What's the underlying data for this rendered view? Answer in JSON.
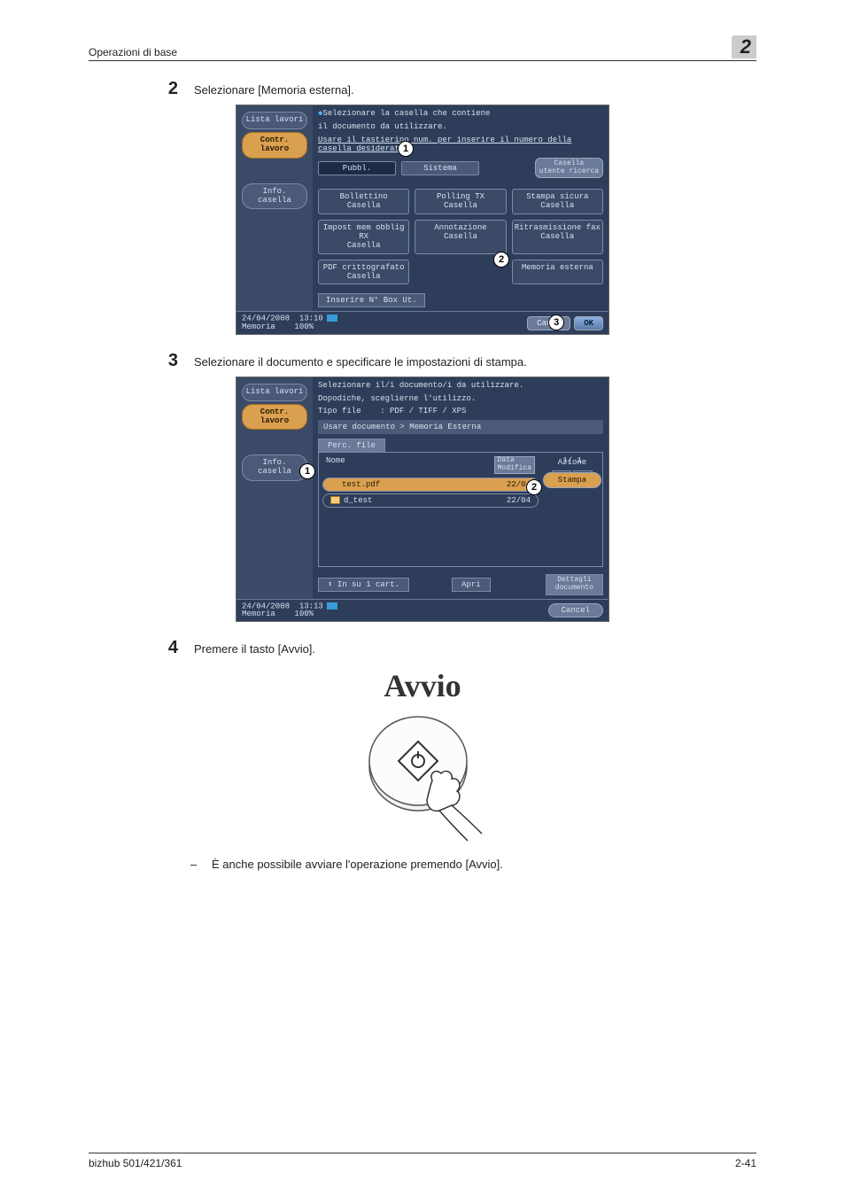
{
  "header": {
    "section": "Operazioni di base",
    "chapter": "2"
  },
  "steps": {
    "s2": {
      "num": "2",
      "text": "Selezionare [Memoria esterna]."
    },
    "s3": {
      "num": "3",
      "text": "Selezionare il documento e specificare le impostazioni di stampa."
    },
    "s4": {
      "num": "4",
      "text": "Premere il tasto [Avvio]."
    }
  },
  "sub4": {
    "bullet": "–",
    "text": "È anche possibile avviare l'operazione premendo [Avvio]."
  },
  "panel1": {
    "sidebar": {
      "lista": "Lista lavori",
      "contr": "Contr.\nlavoro",
      "info": "Info. casella"
    },
    "instr1": "Selezionare la casella che contiene",
    "instr2": "il documento da utilizzare.",
    "instr3": "Usare il tastierino num. per inserire il numero della casella desiderata.",
    "tabs": {
      "pubbl": "Pubbl.",
      "sistema": "Sistema"
    },
    "search": "Casella\nutente ricerca",
    "boxes": {
      "b1": "Bollettino\nCasella",
      "b2": "Polling TX\nCasella",
      "b3": "Stampa sicura\nCasella",
      "b4": "Impost mem obblig RX\nCasella",
      "b5": "Annotazione\nCasella",
      "b6": "Ritrasmissione fax\nCasella",
      "b7": "PDF crittografato\nCasella",
      "b8": "Memoria esterna"
    },
    "enterBox": "Inserire N° Box Ut.",
    "footer": {
      "date": "24/04/2008",
      "time": "13:10",
      "memLabel": "Memoria",
      "memPct": "100%",
      "cancel": "Canc.",
      "ok": "OK"
    },
    "markers": {
      "m1": "1",
      "m2": "2",
      "m3": "3"
    }
  },
  "panel2": {
    "sidebar": {
      "lista": "Lista lavori",
      "contr": "Contr.\nlavoro",
      "info": "Info. casella"
    },
    "instr1": "Selezionare il/i documento/i da utilizzare.",
    "instr2": "Dopodiche, sceglierne l'utilizzo.",
    "instr3fileLabel": "Tipo file",
    "instr3fileVal": ": PDF / TIFF / XPS",
    "breadcrumb": "Usare documento > Memoria Esterna",
    "pathTab": "Perc. file",
    "fileHeader": {
      "name": "Nome",
      "date": "Data\nModifica"
    },
    "files": [
      {
        "icon": "doc",
        "name": "test.pdf",
        "date": "22/04",
        "selected": true
      },
      {
        "icon": "folder",
        "name": "d_test",
        "date": "22/04",
        "selected": false
      }
    ],
    "pageInd": "1/  1",
    "actionHeader": "Azione",
    "actionBtn": "Stampa",
    "bottom": {
      "up": "In su 1 cart.",
      "open": "Apri",
      "detail": "Dettagli\ndocumento"
    },
    "footer": {
      "date": "24/04/2008",
      "time": "13:13",
      "memLabel": "Memoria",
      "memPct": "100%",
      "cancel": "Cancel"
    },
    "markers": {
      "m1": "1",
      "m2": "2"
    }
  },
  "avvio": {
    "label": "Avvio"
  },
  "footer": {
    "left": "bizhub 501/421/361",
    "right": "2-41"
  }
}
